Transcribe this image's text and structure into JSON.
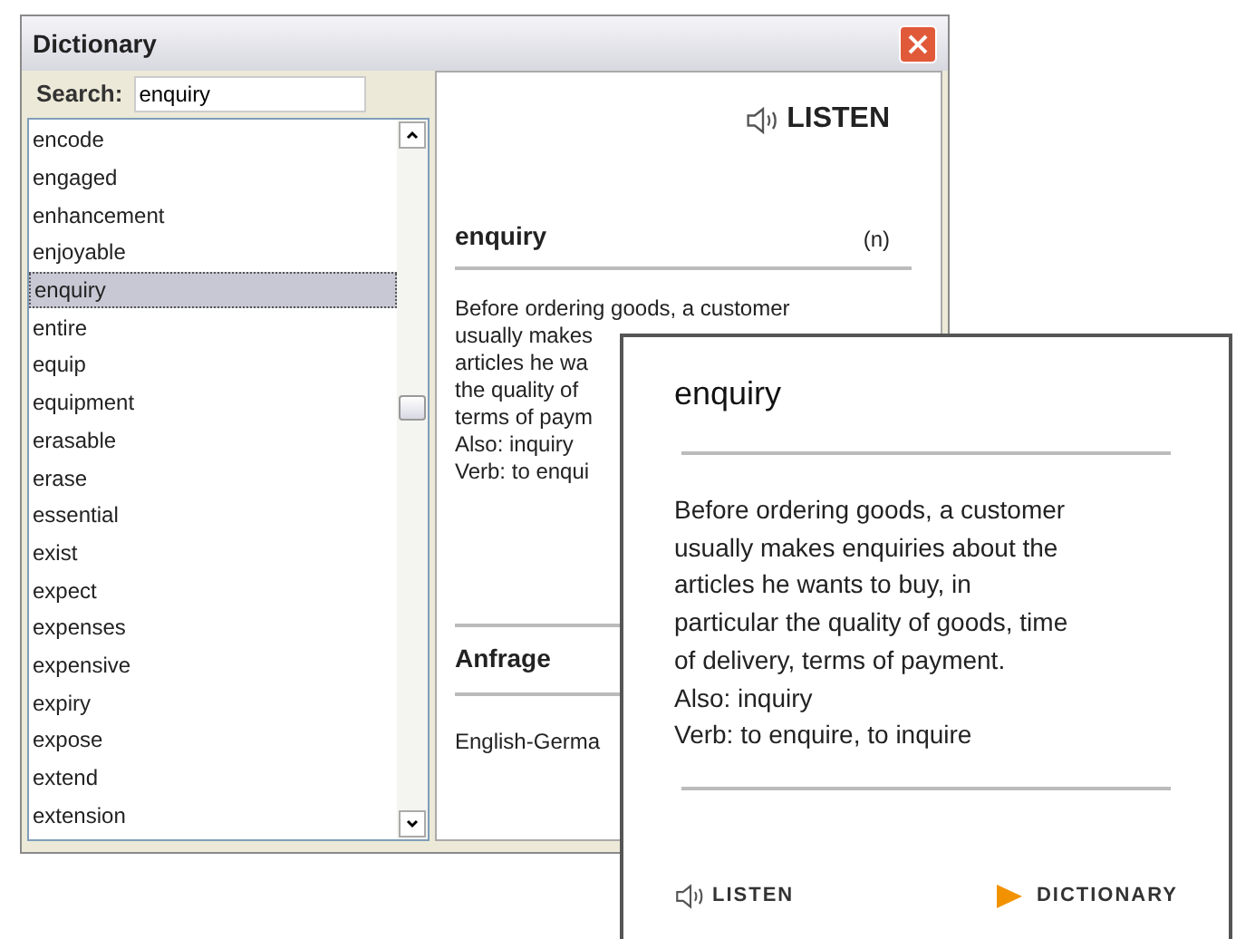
{
  "window": {
    "title": "Dictionary"
  },
  "search": {
    "label": "Search:",
    "value": "enquiry"
  },
  "word_list": [
    {
      "label": "encode",
      "selected": false
    },
    {
      "label": "engaged",
      "selected": false
    },
    {
      "label": "enhancement",
      "selected": false
    },
    {
      "label": "enjoyable",
      "selected": false
    },
    {
      "label": "enquiry",
      "selected": true
    },
    {
      "label": "entire",
      "selected": false
    },
    {
      "label": "equip",
      "selected": false
    },
    {
      "label": "equipment",
      "selected": false
    },
    {
      "label": "erasable",
      "selected": false
    },
    {
      "label": "erase",
      "selected": false
    },
    {
      "label": "essential",
      "selected": false
    },
    {
      "label": "exist",
      "selected": false
    },
    {
      "label": "expect",
      "selected": false
    },
    {
      "label": "expenses",
      "selected": false
    },
    {
      "label": "expensive",
      "selected": false
    },
    {
      "label": "expiry",
      "selected": false
    },
    {
      "label": "expose",
      "selected": false
    },
    {
      "label": "extend",
      "selected": false
    },
    {
      "label": "extension",
      "selected": false
    }
  ],
  "entry": {
    "listen": "LISTEN",
    "headword": "enquiry",
    "part_of_speech": "(n)",
    "definition_lines": [
      "Before ordering goods, a customer",
      "usually makes",
      "articles he wa",
      "the quality of",
      "terms of paym",
      "Also: inquiry",
      "Verb: to enqui"
    ],
    "translation": "Anfrage",
    "language_pair": "English-Germa"
  },
  "popup": {
    "headword": "enquiry",
    "definition_lines": [
      "Before ordering goods, a customer",
      "usually makes enquiries about the",
      "articles he wants to buy, in",
      "particular the quality of goods, time",
      "of delivery, terms of payment.",
      "Also: inquiry",
      "Verb: to enquire, to inquire"
    ],
    "listen": "LISTEN",
    "dictionary": "DICTIONARY"
  }
}
